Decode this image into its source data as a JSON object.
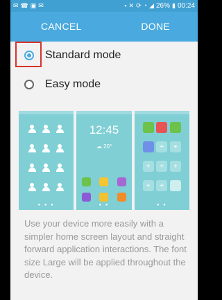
{
  "statusbar": {
    "battery": "26%",
    "time": "00:24",
    "left_icons": [
      "wechat-icon",
      "phone-icon",
      "image-icon",
      "mail-icon"
    ],
    "right_icons": [
      "notify-icon",
      "mute-icon",
      "nfc-icon",
      "vibrate-icon",
      "sync-icon",
      "wifi-icon",
      "signal-icon",
      "battery-icon"
    ]
  },
  "actionbar": {
    "cancel_label": "CANCEL",
    "done_label": "DONE"
  },
  "options": [
    {
      "label": "Standard mode",
      "selected": true
    },
    {
      "label": "Easy mode",
      "selected": false
    }
  ],
  "preview": {
    "clock": "12:45",
    "weather": "20°"
  },
  "description": "Use your device more easily with a simpler home screen layout and straight forward application interactions. The font size Large will be applied throughout the device.",
  "colors": {
    "accent": "#4aaadf",
    "statusbar": "#41a0d2",
    "highlight": "#d9322b",
    "preview_bg": "#7fcfd5"
  }
}
